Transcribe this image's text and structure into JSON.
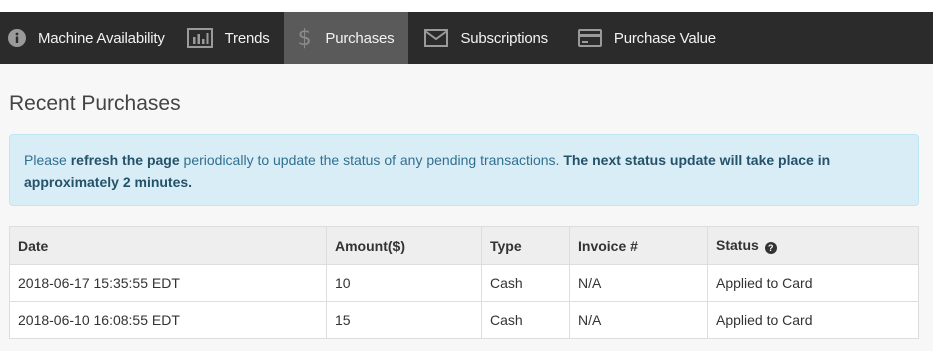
{
  "nav": {
    "items": [
      {
        "label": "Machine Availability",
        "icon": "info-circle-icon",
        "active": false
      },
      {
        "label": "Trends",
        "icon": "bar-chart-icon",
        "active": false
      },
      {
        "label": "Purchases",
        "icon": "dollar-icon",
        "active": true
      },
      {
        "label": "Subscriptions",
        "icon": "envelope-icon",
        "active": false
      },
      {
        "label": "Purchase Value",
        "icon": "credit-card-icon",
        "active": false
      }
    ]
  },
  "page": {
    "title": "Recent Purchases"
  },
  "alert": {
    "prefix": "Please ",
    "link": "refresh the page",
    "middle": " periodically to update the status of any pending transactions. ",
    "bold": "The next status update will take place in approximately 2 minutes."
  },
  "table": {
    "headers": {
      "date": "Date",
      "amount": "Amount($)",
      "type": "Type",
      "invoice": "Invoice #",
      "status": "Status"
    },
    "status_help_glyph": "?",
    "rows": [
      {
        "date": "2018-06-17 15:35:55 EDT",
        "amount": "10",
        "type": "Cash",
        "invoice": "N/A",
        "status": "Applied to Card"
      },
      {
        "date": "2018-06-10 16:08:55 EDT",
        "amount": "15",
        "type": "Cash",
        "invoice": "N/A",
        "status": "Applied to Card"
      }
    ]
  },
  "colors": {
    "navbar_bg": "#2b2b2b",
    "nav_active_bg": "#5a5a5a",
    "alert_bg": "#d9edf7",
    "alert_text": "#31708f"
  }
}
